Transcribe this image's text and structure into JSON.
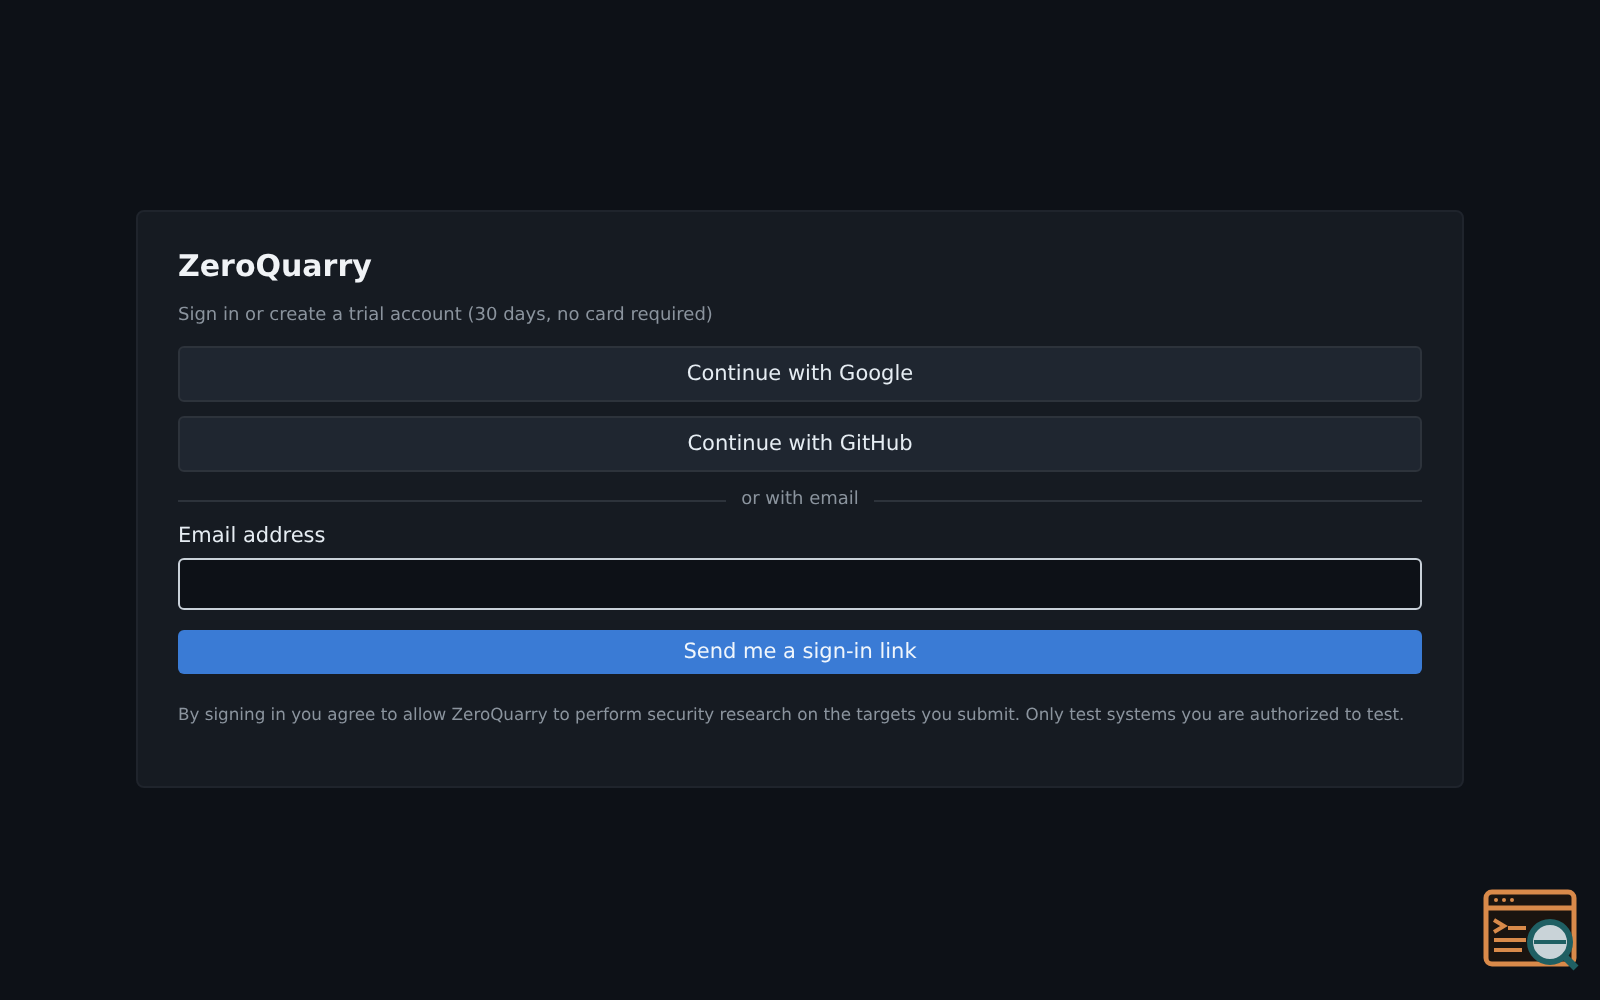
{
  "card": {
    "title": "ZeroQuarry",
    "subtitle": "Sign in or create a trial account (30 days, no card required)",
    "providers": [
      "Continue with Google",
      "Continue with GitHub"
    ],
    "divider": "or with email",
    "email": {
      "label": "Email address"
    },
    "submit": "Send me a sign-in link",
    "disclaimer": "By signing in you agree to allow ZeroQuarry to perform security research on the targets you submit. Only test systems you are authorized to test."
  }
}
